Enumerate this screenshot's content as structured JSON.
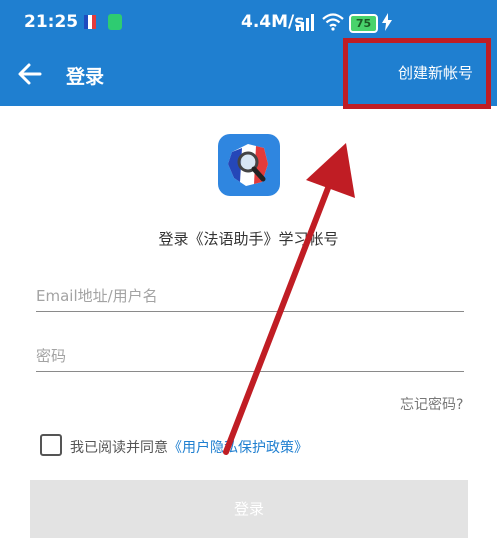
{
  "status_bar": {
    "time": "21:25",
    "net_speed": "4.4M/s",
    "battery": "75",
    "icons": [
      "france-flag-icon",
      "shield-icon",
      "signal-icon",
      "wifi-icon",
      "battery-icon",
      "charging-icon"
    ]
  },
  "app_bar": {
    "title": "登录",
    "create_account": "创建新帐号",
    "color": "#1f7fd0"
  },
  "main": {
    "heading": "登录《法语助手》学习帐号",
    "email_placeholder": "Email地址/用户名",
    "password_placeholder": "密码",
    "forgot_password": "忘记密码?",
    "agree_prefix": "我已阅读并同意",
    "policy_link": "《用户隐私保护政策》",
    "login_button": "登录"
  },
  "annotations": {
    "highlight_color": "#c01d24",
    "arrow_color": "#c01d24"
  }
}
